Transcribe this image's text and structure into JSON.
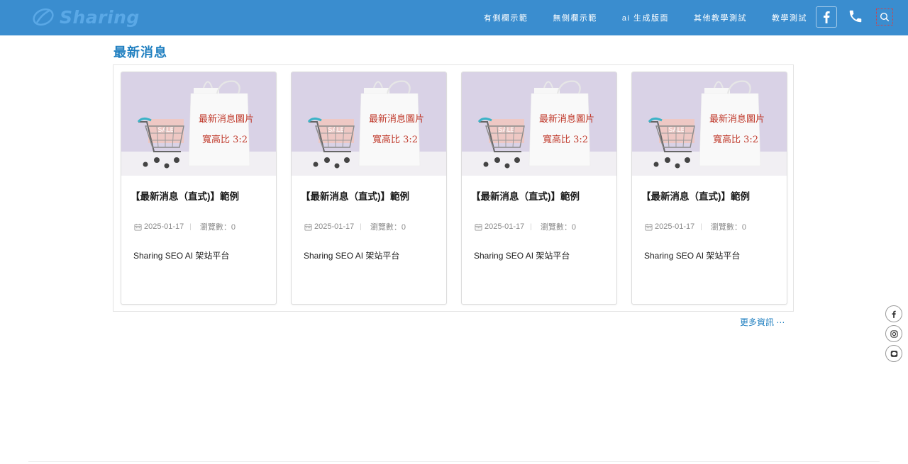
{
  "header": {
    "logo_text": "Sharing",
    "nav": [
      "有側欄示範",
      "無側欄示範",
      "ai 生成版面",
      "其他教學測試",
      "教學測試"
    ],
    "bg_color": "#3a8dcf"
  },
  "icons": {
    "facebook": "facebook-icon",
    "phone": "phone-icon",
    "search": "search-icon",
    "calendar": "calendar-icon",
    "instagram": "instagram-icon",
    "line": "line-icon"
  },
  "main": {
    "title": "最新消息",
    "cards": [
      {
        "image_line1": "最新消息圖片",
        "image_line2": "寬高比 3:2",
        "image_tag": "SALE",
        "title": "【最新消息（直式)】範例",
        "date": "2025-01-17",
        "views": "瀏覽數：0",
        "desc": "Sharing SEO AI 架站平台"
      },
      {
        "image_line1": "最新消息圖片",
        "image_line2": "寬高比 3:2",
        "image_tag": "SALE",
        "title": "【最新消息（直式)】範例",
        "date": "2025-01-17",
        "views": "瀏覽數：0",
        "desc": "Sharing SEO AI 架站平台"
      },
      {
        "image_line1": "最新消息圖片",
        "image_line2": "寬高比 3:2",
        "image_tag": "SALE",
        "title": "【最新消息（直式)】範例",
        "date": "2025-01-17",
        "views": "瀏覽數：0",
        "desc": "Sharing SEO AI 架站平台"
      },
      {
        "image_line1": "最新消息圖片",
        "image_line2": "寬高比 3:2",
        "image_tag": "SALE",
        "title": "【最新消息（直式)】範例",
        "date": "2025-01-17",
        "views": "瀏覽數：0",
        "desc": "Sharing SEO AI 架站平台"
      }
    ],
    "more_link": "更多資訊 ⋯"
  },
  "colors": {
    "accent": "#1f7fc0",
    "image_text": "#c0392b",
    "image_bg": "#d9d2e6"
  }
}
